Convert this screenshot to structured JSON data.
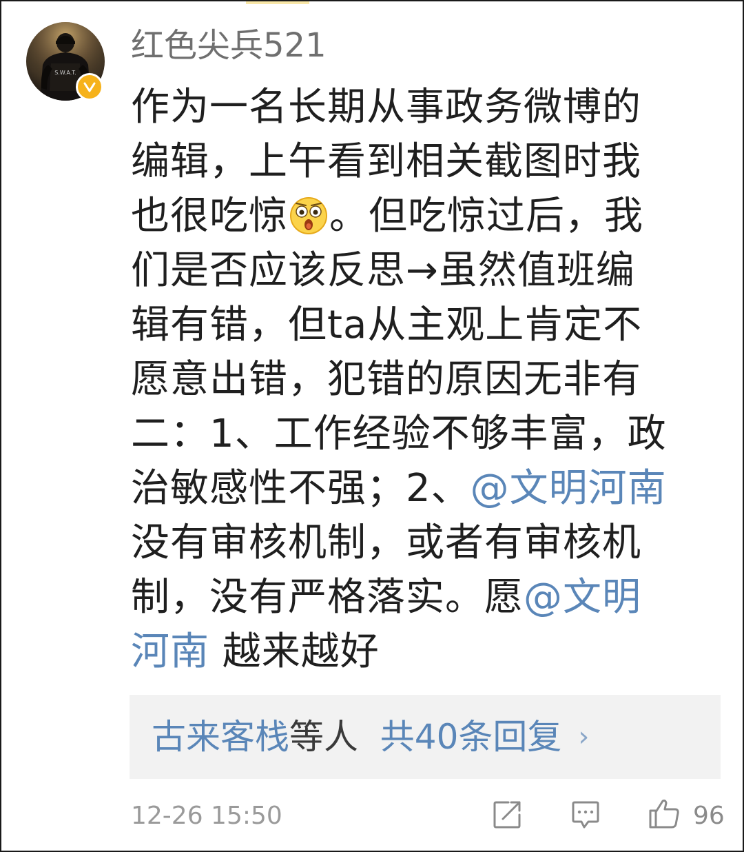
{
  "comment": {
    "username": "红色尖兵521",
    "avatar_icon": "swat-officer-avatar",
    "avatar_text": "S.W.A.T.",
    "verified_icon": "verified-v-badge",
    "lines": {
      "l1": "作为一名长期从事政务微博的",
      "l2": "编辑，上午看到相关截图时我",
      "l3a": "也很吃惊",
      "l3b": "。但吃惊过后，我",
      "l4": "们是否应该反思→虽然值班编",
      "l5": "辑有错，但ta从主观上肯定不",
      "l6": "愿意出错，犯错的原因无非有",
      "l7": "二：1、工作经验不够丰富，政",
      "l8a": "治敏感性不强；2、",
      "l8b": "@文明河南",
      "l9": "没有审核机制，或者有审核机",
      "l10a": "制，没有严格落实。愿",
      "l10b": "@文明",
      "l11a": "河南",
      "l11b": " 越来越好"
    },
    "emoji": "shocked-face-emoji",
    "mention_color": "#5a86b8"
  },
  "replies": {
    "names": "古来客栈",
    "others": "等人",
    "count_label": "共40条回复",
    "chevron": "›"
  },
  "footer": {
    "timestamp": "12-26 15:50",
    "share_icon": "share-icon",
    "comment_icon": "comment-icon",
    "like_icon": "thumbs-up-icon",
    "like_count": "96"
  }
}
